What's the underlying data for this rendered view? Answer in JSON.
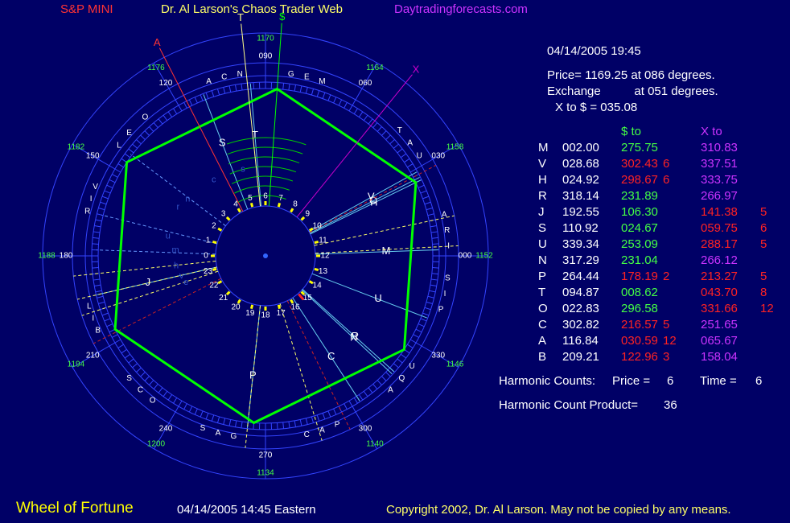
{
  "header": {
    "symbol": "S&P MINI",
    "title": "Dr. Al Larson's Chaos Trader Web",
    "site": "Daytradingforecasts.com"
  },
  "info": {
    "datetime": "04/14/2005 19:45",
    "price_line": "Price= 1169.25 at 086 degrees.",
    "exchange_line": "Exchange          at 051 degrees.",
    "x_to_line": "X to $  = 035.08"
  },
  "table": {
    "col_dollar": "$ to",
    "col_x": "X to",
    "rows": [
      {
        "sym": "M",
        "pos": "002.00",
        "d": "275.75",
        "dc": "",
        "x": "310.83",
        "xc": "",
        "dhit": false,
        "xhit": false
      },
      {
        "sym": "V",
        "pos": "028.68",
        "d": "302.43",
        "dc": "6",
        "x": "337.51",
        "xc": "",
        "dhit": true,
        "xhit": false
      },
      {
        "sym": "H",
        "pos": "024.92",
        "d": "298.67",
        "dc": "6",
        "x": "333.75",
        "xc": "",
        "dhit": true,
        "xhit": false
      },
      {
        "sym": "R",
        "pos": "318.14",
        "d": "231.89",
        "dc": "",
        "x": "266.97",
        "xc": "",
        "dhit": false,
        "xhit": false
      },
      {
        "sym": "J",
        "pos": "192.55",
        "d": "106.30",
        "dc": "",
        "x": "141.38",
        "xc": "5",
        "dhit": false,
        "xhit": true
      },
      {
        "sym": "S",
        "pos": "110.92",
        "d": "024.67",
        "dc": "",
        "x": "059.75",
        "xc": "6",
        "dhit": false,
        "xhit": true
      },
      {
        "sym": "U",
        "pos": "339.34",
        "d": "253.09",
        "dc": "",
        "x": "288.17",
        "xc": "5",
        "dhit": false,
        "xhit": true
      },
      {
        "sym": "N",
        "pos": "317.29",
        "d": "231.04",
        "dc": "",
        "x": "266.12",
        "xc": "",
        "dhit": false,
        "xhit": false
      },
      {
        "sym": "P",
        "pos": "264.44",
        "d": "178.19",
        "dc": "2",
        "x": "213.27",
        "xc": "5",
        "dhit": true,
        "xhit": true
      },
      {
        "sym": "T",
        "pos": "094.87",
        "d": "008.62",
        "dc": "",
        "x": "043.70",
        "xc": "8",
        "dhit": false,
        "xhit": true
      },
      {
        "sym": "O",
        "pos": "022.83",
        "d": "296.58",
        "dc": "",
        "x": "331.66",
        "xc": "12",
        "dhit": false,
        "xhit": true
      },
      {
        "sym": "C",
        "pos": "302.82",
        "d": "216.57",
        "dc": "5",
        "x": "251.65",
        "xc": "",
        "dhit": true,
        "xhit": false
      },
      {
        "sym": "A",
        "pos": "116.84",
        "d": "030.59",
        "dc": "12",
        "x": "065.67",
        "xc": "",
        "dhit": true,
        "xhit": false
      },
      {
        "sym": "B",
        "pos": "209.21",
        "d": "122.96",
        "dc": "3",
        "x": "158.04",
        "xc": "",
        "dhit": true,
        "xhit": false
      }
    ]
  },
  "harmonics": {
    "counts_label": "Harmonic Counts:",
    "price_label": "Price =",
    "price_value": "6",
    "time_label": "Time =",
    "time_value": "6",
    "product_label": "Harmonic Count Product=",
    "product_value": "36"
  },
  "footer": {
    "wheel_title": "Wheel of Fortune",
    "eastern_time": "04/14/2005 14:45 Eastern",
    "copyright": "Copyright 2002, Dr. Al Larson. May not be copied by any means."
  },
  "colors": {
    "background": "#000066",
    "hexagon": "#00ff00",
    "circle": "#3344ff",
    "hit": "#ff2222",
    "x_col": "#cc33ff",
    "dollar_col": "#44ff44"
  },
  "chart_data": {
    "type": "radial",
    "degree_labels": [
      "000",
      "030",
      "060",
      "090",
      "120",
      "150",
      "180",
      "210",
      "240",
      "270",
      "300",
      "330"
    ],
    "price_labels": [
      {
        "deg": 0,
        "label": "1152"
      },
      {
        "deg": 30,
        "label": "1158"
      },
      {
        "deg": 60,
        "label": "1164"
      },
      {
        "deg": 90,
        "label": "1170"
      },
      {
        "deg": 120,
        "label": "1176"
      },
      {
        "deg": 150,
        "label": "1182"
      },
      {
        "deg": 180,
        "label": "1188"
      },
      {
        "deg": 210,
        "label": "1194"
      },
      {
        "deg": 240,
        "label": "1200"
      },
      {
        "deg": 270,
        "label": "1134"
      },
      {
        "deg": 300,
        "label": "1140"
      },
      {
        "deg": 330,
        "label": "1146"
      }
    ],
    "hour_labels": [
      "0",
      "1",
      "2",
      "3",
      "4",
      "5",
      "6",
      "7",
      "8",
      "9",
      "10",
      "11",
      "12",
      "13",
      "14",
      "15",
      "16",
      "17",
      "18",
      "19",
      "20",
      "21",
      "22",
      "23"
    ],
    "pointers": [
      {
        "label": "$",
        "deg": 86,
        "color": "#00ff00"
      },
      {
        "label": "X",
        "deg": 51,
        "color": "#cc00cc"
      },
      {
        "label": "T",
        "deg": 96,
        "color": "#ffff88"
      },
      {
        "label": "A",
        "deg": 117,
        "color": "#ff3333"
      }
    ],
    "inner_planets": [
      {
        "sym": "V",
        "deg": 29
      },
      {
        "sym": "H",
        "deg": 26
      },
      {
        "sym": "C",
        "deg": 27
      },
      {
        "sym": "M",
        "deg": 2
      },
      {
        "sym": "U",
        "deg": 339
      },
      {
        "sym": "R",
        "deg": 318
      },
      {
        "sym": "N",
        "deg": 317
      },
      {
        "sym": "C",
        "deg": 303
      },
      {
        "sym": "P",
        "deg": 264
      },
      {
        "sym": "J",
        "deg": 193
      },
      {
        "sym": "S",
        "deg": 111
      },
      {
        "sym": "T",
        "deg": 95
      }
    ],
    "zodiac_letters": [
      {
        "ch": "G",
        "deg": 82
      },
      {
        "ch": "E",
        "deg": 77
      },
      {
        "ch": "M",
        "deg": 72
      },
      {
        "ch": "T",
        "deg": 43
      },
      {
        "ch": "A",
        "deg": 38
      },
      {
        "ch": "U",
        "deg": 33
      },
      {
        "ch": "C",
        "deg": 103
      },
      {
        "ch": "A",
        "deg": 108
      },
      {
        "ch": "N",
        "deg": 98
      },
      {
        "ch": "O",
        "deg": 131
      },
      {
        "ch": "E",
        "deg": 138
      },
      {
        "ch": "L",
        "deg": 143
      },
      {
        "ch": "R",
        "deg": 166
      },
      {
        "ch": "I",
        "deg": 162
      },
      {
        "ch": "V",
        "deg": 158
      },
      {
        "ch": "L",
        "deg": 196
      },
      {
        "ch": "I",
        "deg": 200
      },
      {
        "ch": "B",
        "deg": 204
      },
      {
        "ch": "S",
        "deg": 222
      },
      {
        "ch": "C",
        "deg": 227
      },
      {
        "ch": "O",
        "deg": 232
      },
      {
        "ch": "S",
        "deg": 250
      },
      {
        "ch": "A",
        "deg": 255
      },
      {
        "ch": "G",
        "deg": 260
      },
      {
        "ch": "C",
        "deg": 283
      },
      {
        "ch": "A",
        "deg": 288
      },
      {
        "ch": "P",
        "deg": 293
      },
      {
        "ch": "A",
        "deg": 313
      },
      {
        "ch": "Q",
        "deg": 318
      },
      {
        "ch": "U",
        "deg": 323
      },
      {
        "ch": "P",
        "deg": 343
      },
      {
        "ch": "I",
        "deg": 348
      },
      {
        "ch": "S",
        "deg": 353
      },
      {
        "ch": "A",
        "deg": 13
      },
      {
        "ch": "R",
        "deg": 8
      },
      {
        "ch": "I",
        "deg": 3
      }
    ],
    "hexagon_vertices_deg": [
      86,
      26,
      326,
      266,
      206,
      146
    ]
  }
}
